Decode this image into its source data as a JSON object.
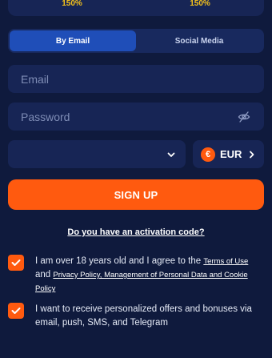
{
  "bonus": {
    "left_pct": "150%",
    "right_pct": "150%"
  },
  "tabs": [
    {
      "label": "By Email",
      "active": true
    },
    {
      "label": "Social Media",
      "active": false
    }
  ],
  "form": {
    "email_placeholder": "Email",
    "password_placeholder": "Password",
    "country_value": "",
    "currency_symbol": "€",
    "currency_code": "EUR"
  },
  "signup_label": "SIGN UP",
  "activation_label": "Do you have an activation code?",
  "consent": {
    "age_text_1": "I am over 18 years old and I agree to the ",
    "terms_link": "Terms of Use",
    "and_text": "and ",
    "privacy_link": "Privacy Policy, Management of Personal Data and Cookie Policy",
    "offers_text": "I want to receive personalized offers and bonuses via email, push, SMS, and Telegram"
  },
  "colors": {
    "background": "#0f1a3d",
    "panel": "#172555",
    "accent": "#ff5a0f",
    "active_tab": "#1f4eb8",
    "bonus_yellow": "#f5c21b"
  },
  "icons": {
    "password_toggle": "eye-slash-icon",
    "country_dropdown": "chevron-down-icon",
    "currency_arrow": "chevron-right-icon",
    "checkbox": "checkmark-icon"
  }
}
